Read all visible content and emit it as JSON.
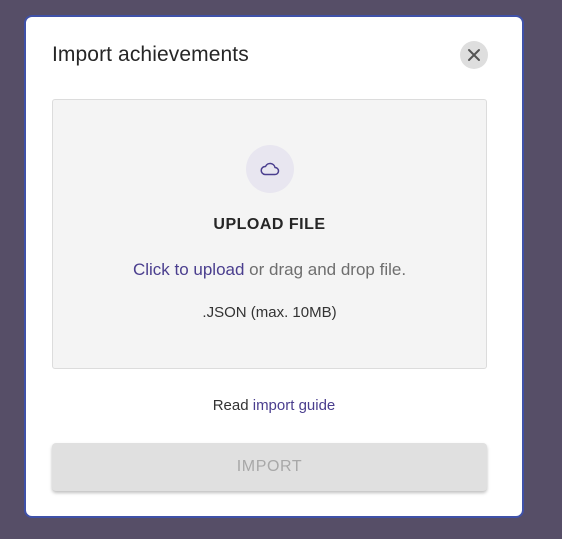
{
  "modal": {
    "title": "Import achievements",
    "close_icon": "close-icon"
  },
  "dropzone": {
    "icon": "cloud-icon",
    "title": "UPLOAD FILE",
    "click_link": "Click to upload",
    "drag_text": " or drag and drop file.",
    "format_note": ".JSON (max. 10MB)"
  },
  "guide": {
    "prefix": "Read ",
    "link": "import guide"
  },
  "actions": {
    "import_label": "IMPORT"
  },
  "colors": {
    "backdrop": "#564e67",
    "accent": "#4a3e8e",
    "border": "#3f51a8"
  }
}
